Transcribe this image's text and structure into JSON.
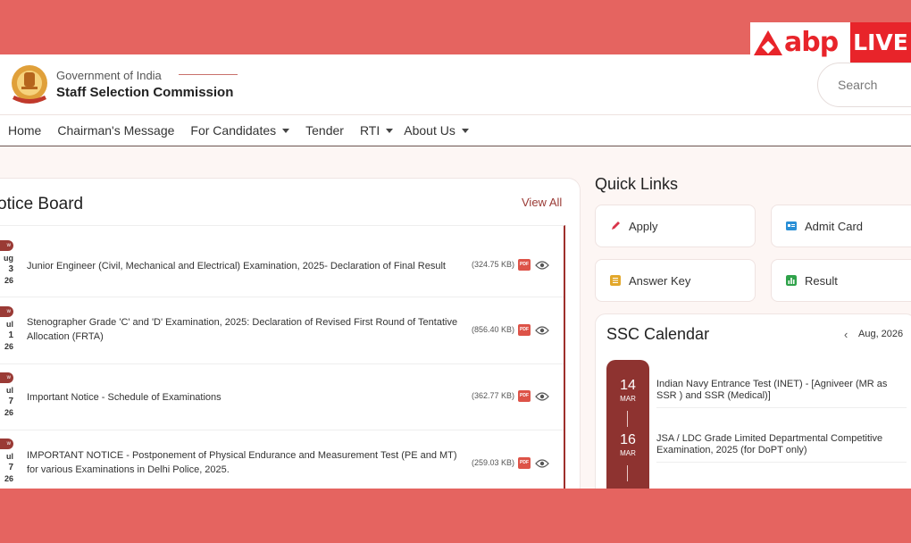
{
  "brand": {
    "abp": "abp",
    "live": "LIVE"
  },
  "header": {
    "gov_line": "Government of India",
    "org_name": "Staff Selection Commission",
    "search_placeholder": "Search"
  },
  "nav": {
    "items": [
      {
        "label": "Home",
        "has_caret": false
      },
      {
        "label": "Chairman's Message",
        "has_caret": false
      },
      {
        "label": "For Candidates",
        "has_caret": true
      },
      {
        "label": "Tender",
        "has_caret": false
      },
      {
        "label": "RTI",
        "has_caret": true
      },
      {
        "label": "About Us",
        "has_caret": true
      }
    ]
  },
  "notice_board": {
    "title": "otice Board",
    "view_all": "View All",
    "items": [
      {
        "badge": "w",
        "month": "ug",
        "day": "3",
        "year": "26",
        "text": "Junior Engineer (Civil, Mechanical and Electrical) Examination, 2025- Declaration of Final Result",
        "size": "(324.75 KB)"
      },
      {
        "badge": "w",
        "month": "ul",
        "day": "1",
        "year": "26",
        "text": "Stenographer Grade 'C' and 'D' Examination, 2025: Declaration of Revised First Round of Tentative Allocation (FRTA)",
        "size": "(856.40 KB)"
      },
      {
        "badge": "w",
        "month": "ul",
        "day": "7",
        "year": "26",
        "text": "Important Notice - Schedule of Examinations",
        "size": "(362.77 KB)"
      },
      {
        "badge": "w",
        "month": "ul",
        "day": "7",
        "year": "26",
        "text": "IMPORTANT NOTICE - Postponement of Physical Endurance and Measurement Test (PE and MT) for various Examinations in Delhi Police, 2025.",
        "size": "(259.03 KB)"
      }
    ],
    "pdf_label": "PDF"
  },
  "quick_links": {
    "title": "Quick Links",
    "items": [
      {
        "label": "Apply",
        "icon": "pencil-icon",
        "color": "#d9344a"
      },
      {
        "label": "Admit Card",
        "icon": "id-card-icon",
        "color": "#2a8fd6"
      },
      {
        "label": "Answer Key",
        "icon": "list-icon",
        "color": "#e2a72a"
      },
      {
        "label": "Result",
        "icon": "bar-chart-icon",
        "color": "#2fa24a"
      }
    ]
  },
  "calendar": {
    "title": "SSC Calendar",
    "prev": "‹",
    "month": "Aug, 2026",
    "events": [
      {
        "day": "14",
        "month": "MAR",
        "text": "Indian Navy Entrance Test (INET) - [Agniveer (MR as SSR ) and SSR (Medical)]"
      },
      {
        "day": "16",
        "month": "MAR",
        "text": "JSA / LDC Grade Limited Departmental Competitive Examination, 2025 (for DoPT only)"
      }
    ]
  },
  "colors": {
    "frame": "#e56460",
    "accent": "#9a3a35",
    "calendar_rail": "#8e3330",
    "abp_red": "#e8242a"
  }
}
